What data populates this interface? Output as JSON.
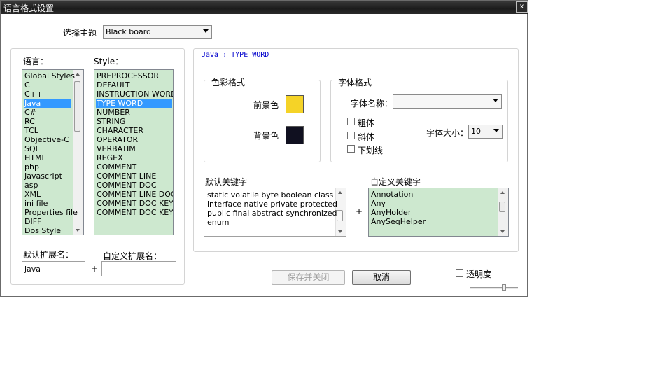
{
  "window": {
    "title": "语言格式设置",
    "close_label": "x"
  },
  "theme": {
    "label": "选择主题",
    "value": "Black board"
  },
  "languages": {
    "label": "语言：",
    "items": [
      "Global Styles",
      "C",
      "C++",
      "Java",
      "C#",
      "RC",
      "TCL",
      "Objective-C",
      "SQL",
      "HTML",
      "php",
      "Javascript",
      "asp",
      "XML",
      "ini file",
      "Properties file",
      "DIFF",
      "Dos Style"
    ],
    "selected": "Java"
  },
  "styles": {
    "label": "Style：",
    "items": [
      "PREPROCESSOR",
      "DEFAULT",
      "INSTRUCTION WORD",
      "TYPE WORD",
      "NUMBER",
      "STRING",
      "CHARACTER",
      "OPERATOR",
      "VERBATIM",
      "REGEX",
      "COMMENT",
      "COMMENT LINE",
      "COMMENT DOC",
      "COMMENT LINE DOC",
      "COMMENT DOC KEYWORD",
      "COMMENT DOC KEYWORD ERROR"
    ],
    "selected": "TYPE WORD"
  },
  "extensions": {
    "default_label": "默认扩展名：",
    "default_value": "java",
    "custom_label": "自定义扩展名：",
    "custom_value": "",
    "plus": "+"
  },
  "preview": {
    "text": "Java : TYPE WORD",
    "color": "#0000cc"
  },
  "color_format": {
    "title": "色彩格式",
    "fg_label": "前景色",
    "fg_color": "#f5d327",
    "bg_label": "背景色",
    "bg_color": "#101020"
  },
  "font_format": {
    "title": "字体格式",
    "name_label": "字体名称：",
    "name_value": "",
    "bold_label": "粗体",
    "italic_label": "斜体",
    "underline_label": "下划线",
    "size_label": "字体大小：",
    "size_value": "10"
  },
  "keywords": {
    "default_label": "默认关键字",
    "default_lines": [
      "static volatile byte boolean class",
      "interface native private protected",
      "public final abstract synchronized",
      "enum"
    ],
    "plus": "+",
    "custom_label": "自定义关键字",
    "custom_items": [
      "Annotation",
      "Any",
      "AnyHolder",
      "AnySeqHelper"
    ]
  },
  "buttons": {
    "save_close": "保存并关闭",
    "cancel": "取消"
  },
  "transparency": {
    "label": "透明度"
  }
}
